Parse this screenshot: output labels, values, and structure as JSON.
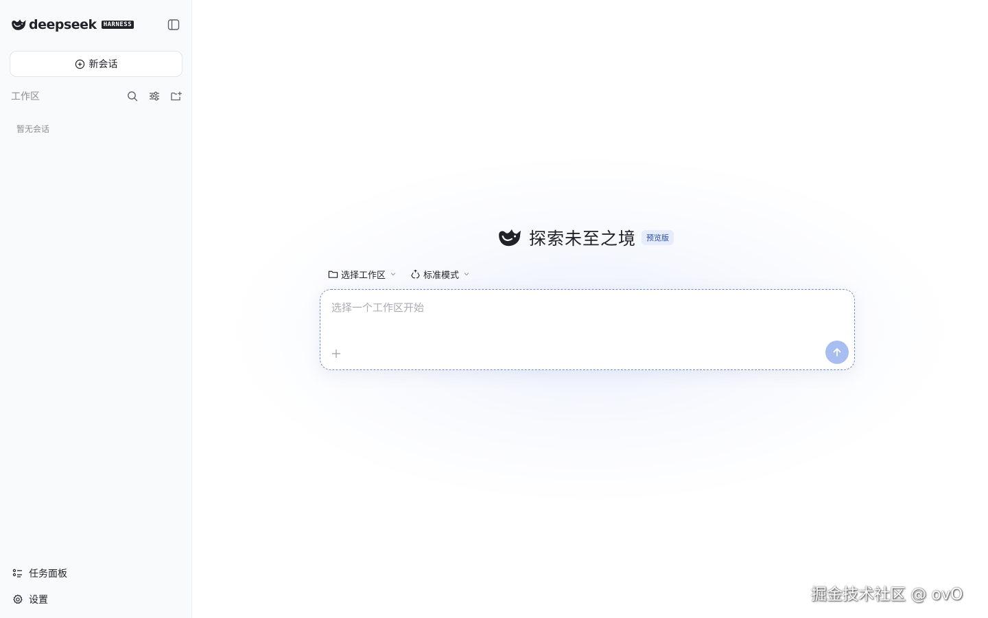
{
  "sidebar": {
    "brand": {
      "name": "deepseek",
      "badge": "HARNESS",
      "icon": "whale-logo"
    },
    "collapse_icon": "sidebar-toggle-icon",
    "new_chat": {
      "label": "新会话",
      "icon": "plus-circle-icon"
    },
    "workspace": {
      "label": "工作区",
      "actions": [
        "search-icon",
        "filter-sliders-icon",
        "new-folder-icon"
      ]
    },
    "empty_text": "暂无会话",
    "bottom": [
      {
        "label": "任务面板",
        "icon": "task-list-icon"
      },
      {
        "label": "设置",
        "icon": "gear-icon"
      }
    ]
  },
  "main": {
    "hero": {
      "title": "探索未至之境",
      "badge": "预览版",
      "icon": "whale-logo"
    },
    "toolbar": {
      "workspace_select": {
        "label": "选择工作区",
        "icon": "folder-icon"
      },
      "mode_select": {
        "label": "标准模式",
        "icon": "recycle-icon"
      }
    },
    "composer": {
      "placeholder": "选择一个工作区开始",
      "value": "",
      "attach_icon": "plus-icon",
      "send_icon": "arrow-up-icon"
    }
  },
  "watermark": "掘金技术社区 @ ovO",
  "colors": {
    "sidebar_bg": "#f9fafb",
    "accent": "#4d6bfe",
    "send_disabled": "#a8bdf0",
    "badge_bg": "#e6ecfb",
    "badge_text": "#2b4ea8"
  }
}
